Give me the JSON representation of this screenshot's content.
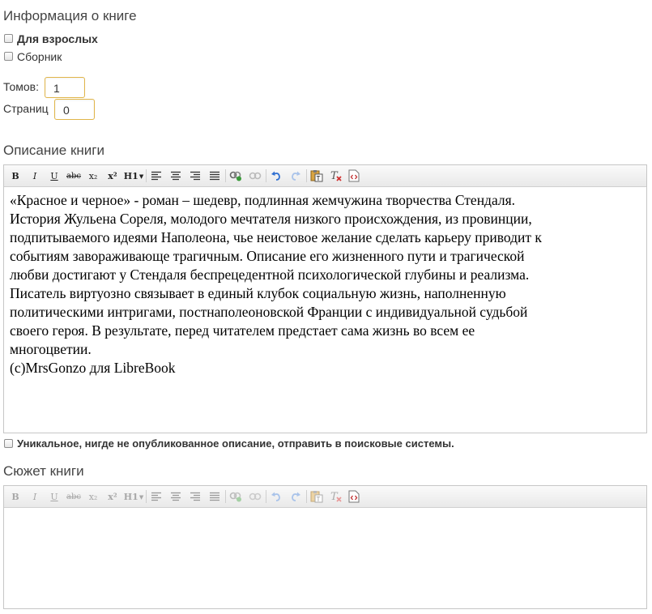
{
  "book_info": {
    "title": "Информация о книге",
    "adult_label": "Для взрослых",
    "collection_label": "Сборник",
    "volumes_label": "Томов:",
    "volumes_value": "1",
    "pages_label": "Страниц",
    "pages_value": "0"
  },
  "description": {
    "title": "Описание книги",
    "paragraph": [
      "«Красное и черное» - роман – шедевр, подлинная жемчужина творчества Стендаля.",
      "История Жульена Сореля, молодого мечтателя низкого происхождения, из провинции,",
      "подпитываемого идеями Наполеона, чье неистовое желание сделать карьеру приводит к",
      "событиям завораживающе трагичным. Описание его жизненного пути и трагической",
      "любви достигают у Стендаля беспрецедентной психологической глубины и реализма.",
      "Писатель виртуозно связывает в единый клубок социальную жизнь, наполненную",
      "политическими интригами, постнаполеоновской Франции с индивидуальной судьбой",
      "своего героя. В результате, перед читателем предстает сама жизнь во всем ее",
      "многоцветии."
    ],
    "signature": "(c)MrsGonzo для LibreBook",
    "unique_label": "Уникальное, нигде не опубликованное описание, отправить в поисковые системы."
  },
  "plot": {
    "title": "Сюжет книги"
  },
  "toolbar": {
    "bold": "B",
    "italic": "I",
    "underline": "U",
    "strike": "abc",
    "subscript": "x₂",
    "superscript": "x²",
    "heading": "H1",
    "icons": [
      "bold-icon",
      "italic-icon",
      "underline-icon",
      "strikethrough-icon",
      "subscript-icon",
      "superscript-icon",
      "heading-dropdown-icon",
      "align-left-icon",
      "align-center-icon",
      "align-right-icon",
      "justify-icon",
      "link-icon",
      "unlink-icon",
      "undo-icon",
      "redo-icon",
      "paste-text-icon",
      "remove-format-icon",
      "source-code-icon"
    ]
  },
  "colors": {
    "field_border": "#e0b54a",
    "editor_border": "#c6c6c6",
    "link_icon": "#3a9a3a",
    "undo_icon": "#2f6fd1",
    "remove_x": "#d03030"
  }
}
